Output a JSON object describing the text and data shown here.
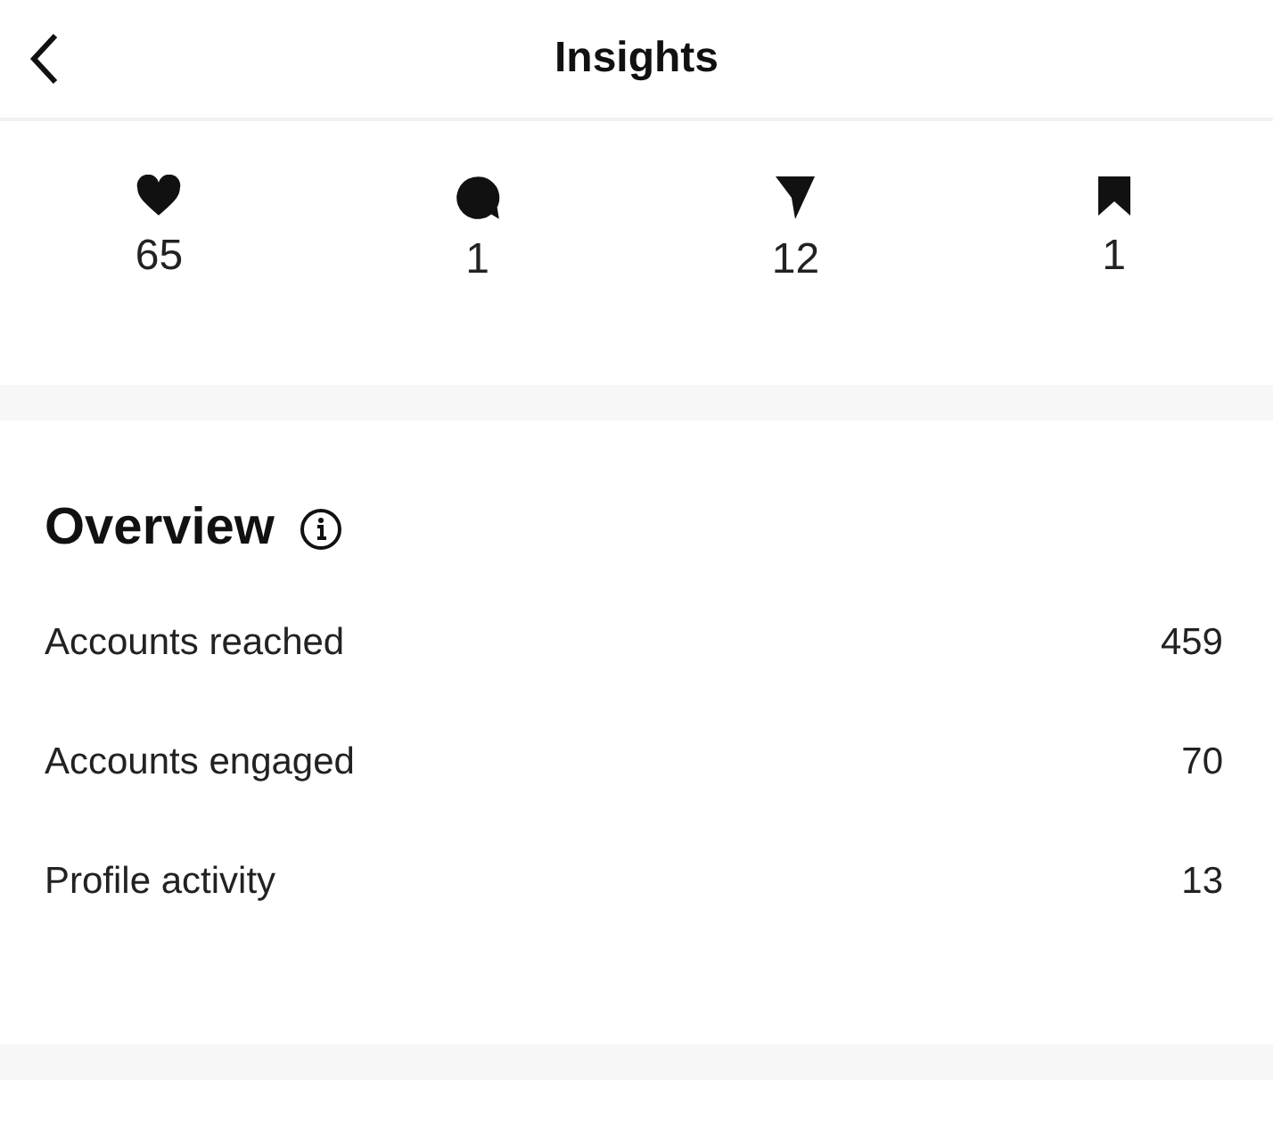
{
  "header": {
    "title": "Insights"
  },
  "stats": [
    {
      "kind": "likes",
      "value": "65"
    },
    {
      "kind": "comments",
      "value": "1"
    },
    {
      "kind": "shares",
      "value": "12"
    },
    {
      "kind": "saves",
      "value": "1"
    }
  ],
  "overview": {
    "title": "Overview",
    "rows": [
      {
        "label": "Accounts reached",
        "value": "459"
      },
      {
        "label": "Accounts engaged",
        "value": "70"
      },
      {
        "label": "Profile activity",
        "value": "13"
      }
    ]
  }
}
